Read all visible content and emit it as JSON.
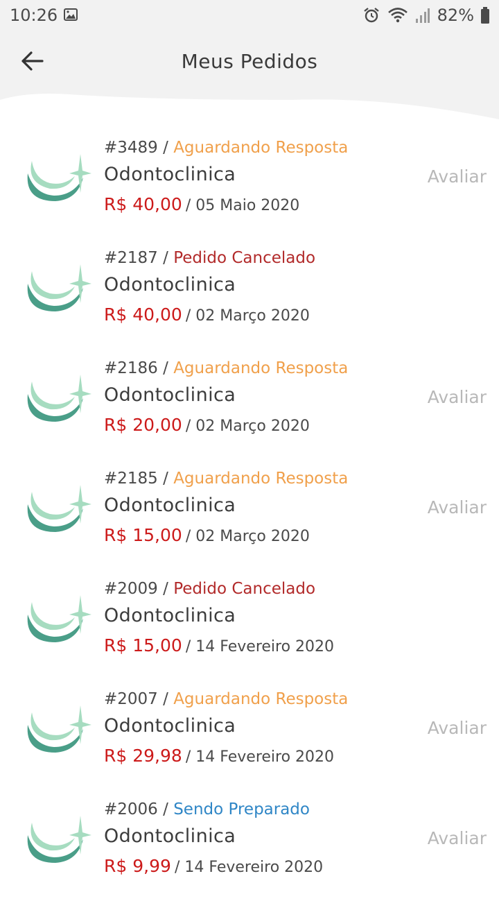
{
  "status_bar": {
    "time": "10:26",
    "battery": "82%"
  },
  "header": {
    "title": "Meus Pedidos"
  },
  "orders": [
    {
      "id": "#3489",
      "status": "Aguardando Resposta",
      "status_type": "await",
      "clinic": "Odontoclinica",
      "price": "R$ 40,00",
      "date": "/ 05 Maio 2020",
      "rate_label": "Avaliar"
    },
    {
      "id": "#2187",
      "status": "Pedido Cancelado",
      "status_type": "cancel",
      "clinic": "Odontoclinica",
      "price": "R$ 40,00",
      "date": "/ 02 Março 2020",
      "rate_label": ""
    },
    {
      "id": "#2186",
      "status": "Aguardando Resposta",
      "status_type": "await",
      "clinic": "Odontoclinica",
      "price": "R$ 20,00",
      "date": "/ 02 Março 2020",
      "rate_label": "Avaliar"
    },
    {
      "id": "#2185",
      "status": "Aguardando Resposta",
      "status_type": "await",
      "clinic": "Odontoclinica",
      "price": "R$ 15,00",
      "date": "/ 02 Março 2020",
      "rate_label": "Avaliar"
    },
    {
      "id": "#2009",
      "status": "Pedido Cancelado",
      "status_type": "cancel",
      "clinic": "Odontoclinica",
      "price": "R$ 15,00",
      "date": "/ 14 Fevereiro 2020",
      "rate_label": ""
    },
    {
      "id": "#2007",
      "status": "Aguardando Resposta",
      "status_type": "await",
      "clinic": "Odontoclinica",
      "price": "R$ 29,98",
      "date": "/ 14 Fevereiro 2020",
      "rate_label": "Avaliar"
    },
    {
      "id": "#2006",
      "status": "Sendo Preparado",
      "status_type": "prep",
      "clinic": "Odontoclinica",
      "price": "R$ 9,99",
      "date": "/ 14 Fevereiro 2020",
      "rate_label": "Avaliar"
    }
  ],
  "colors": {
    "await": "#f0a04b",
    "cancel": "#b22a2a",
    "prep": "#2f86c6",
    "price": "#cc1a1a",
    "rate": "#b8b8b8"
  },
  "icons": {
    "back": "arrow-left-icon",
    "logo": "clinic-logo-icon"
  }
}
